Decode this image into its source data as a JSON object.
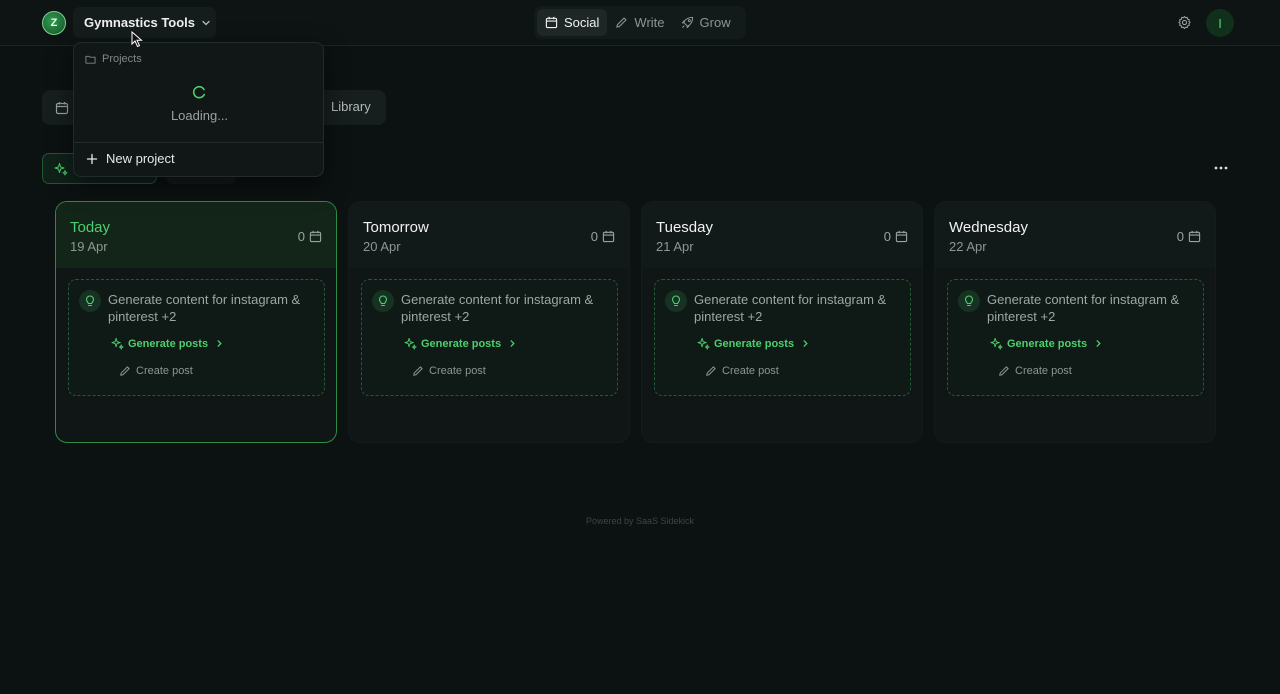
{
  "header": {
    "project_name": "Gymnastics Tools",
    "nav": [
      {
        "label": "Social",
        "icon": "calendar-icon",
        "active": true
      },
      {
        "label": "Write",
        "icon": "pencil-icon",
        "active": false
      },
      {
        "label": "Grow",
        "icon": "rocket-icon",
        "active": false
      }
    ],
    "avatar_initial": "I"
  },
  "dropdown": {
    "section_label": "Projects",
    "loading_text": "Loading...",
    "new_project_label": "New project"
  },
  "toolbar": {
    "library_label": "Library"
  },
  "days": [
    {
      "name": "Today",
      "date": "19 Apr",
      "count": "0",
      "today": true
    },
    {
      "name": "Tomorrow",
      "date": "20 Apr",
      "count": "0",
      "today": false
    },
    {
      "name": "Tuesday",
      "date": "21 Apr",
      "count": "0",
      "today": false
    },
    {
      "name": "Wednesday",
      "date": "22 Apr",
      "count": "0",
      "today": false
    }
  ],
  "suggestion": {
    "text": "Generate content for instagram & pinterest +2",
    "generate_label": "Generate posts",
    "create_label": "Create post"
  },
  "footer": {
    "text": "Powered by SaaS Sidekick"
  },
  "colors": {
    "accent": "#4ccf6d",
    "background": "#0c1112"
  }
}
